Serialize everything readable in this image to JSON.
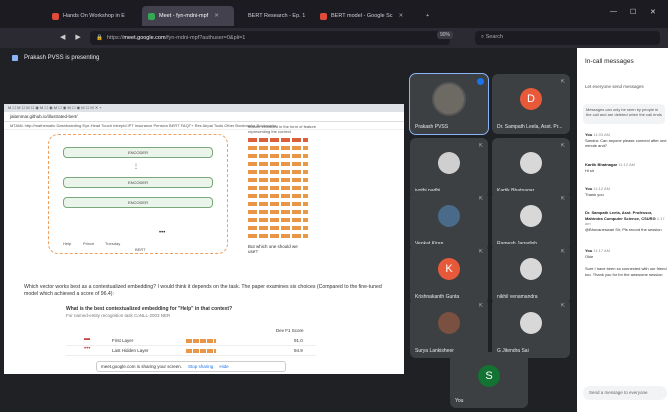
{
  "tabs": [
    {
      "label": "Hands On Workshop in E",
      "active": false
    },
    {
      "label": "Meet - fyn-mdni-mpf",
      "sub": "Is active",
      "active": true
    },
    {
      "label": "BERT Research - Ep. 1",
      "active": false
    },
    {
      "label": "BERT model - Google Sc",
      "active": false
    }
  ],
  "url": {
    "prefix": "https://",
    "host": "meet.google.com",
    "path": "/fyn-mdni-mpf?authuser=0&pli=1"
  },
  "zoom": "90%",
  "search_placeholder": "Search",
  "presenting": "Prakash PVSS is presenting",
  "shared": {
    "tab_strip": "M  ☐ M  ☐ M  ☐ ◉  M  ☐ ◉  M  ☐ ◉  M  ☐ ◉  M  ☐ M  ✕  +",
    "url": "jalammar.github.io/illustrated-bert/",
    "bookmarks": "MTAML   http://mathematic   Dashboarding   Eye-Head Touch   Intrepid   IPT   Insurance   Pension   BERT FAQT+ Res   Airpal Tools   Other Bookmarks   Bookmarks",
    "encoder_label": "ENCODER",
    "diagram_labels": [
      "Help",
      "Prince",
      "Tuesday",
      "BERT"
    ],
    "side_note": "feature extracted in the form of feature representing the context",
    "question": "But which one should we use?",
    "para": "Which vector works best as a contextualized embedding? I would think it depends on the task. The paper examines six choices (Compared to the fine-tuned model which achieved a score of 96.4):",
    "q_title": "What is the best contextualized embedding for \"Help\" in that context?",
    "q_sub": "For named-entity recognition task CoNLL-2003 NER",
    "table_header": "Dev F1 Score",
    "rows": [
      {
        "label": "First Layer",
        "value": "91.0"
      },
      {
        "label": "Last Hidden Layer",
        "value": "94.9"
      }
    ],
    "stop_text": "meet.google.com is sharing your screen.",
    "stop_btn": "Stop sharing",
    "hide_btn": "Hide"
  },
  "participants": [
    {
      "name": "Prakash PVSS",
      "letter": "",
      "color": "#6d6a64",
      "active": true
    },
    {
      "name": "Dr. Sampath Leela, Asst. Pr...",
      "letter": "D",
      "color": "#e8593a"
    },
    {
      "name": "jyothi padhi",
      "letter": "",
      "color": "#cfcfcf"
    },
    {
      "name": "Kartik Bhatnagar",
      "letter": "",
      "color": "#d8d8d8"
    },
    {
      "name": "Venkat Kiran",
      "letter": "",
      "color": "#4a6a8a"
    },
    {
      "name": "Ramesh Jagadish",
      "letter": "",
      "color": "#d8d8d8"
    },
    {
      "name": "Krishnakanth Gunta",
      "letter": "K",
      "color": "#e8593a"
    },
    {
      "name": "nikhil yenamandra",
      "letter": "",
      "color": "#d8d8d8"
    },
    {
      "name": "Surya Lankisheer",
      "letter": "",
      "color": "#7a5040"
    },
    {
      "name": "G Jitendra Sai",
      "letter": "",
      "color": "#d8d8d8"
    },
    {
      "name": "You",
      "letter": "S",
      "color": "#137333"
    }
  ],
  "chat": {
    "title": "In-call messages",
    "option": "Let everyone send messages",
    "notice": "Messages can only be seen by people in the call and are deleted when the call ends",
    "messages": [
      {
        "who": "You",
        "time": "11:03 AM",
        "text": "Sandra: Can anyone please connect after one minute and?"
      },
      {
        "who": "Kartik Bhatnagar",
        "time": "11:12 AM",
        "text": "Hi sir"
      },
      {
        "who": "You",
        "time": "11:12 AM",
        "text": "Thank you"
      },
      {
        "who": "Dr. Sampath Leela, Asst. Professor, Mahindra Computer Science, CSURG",
        "time": "1:17 am",
        "text": "@Bhuvaneswari Sir, Pls record the session"
      },
      {
        "who": "You",
        "time": "11:17 AM",
        "text": "Okie"
      },
      {
        "who": "",
        "time": "",
        "text": "Sure I have been so connected with our friend too. Thank you for for the awesome session"
      }
    ],
    "input_placeholder": "Send a message to everyone"
  }
}
